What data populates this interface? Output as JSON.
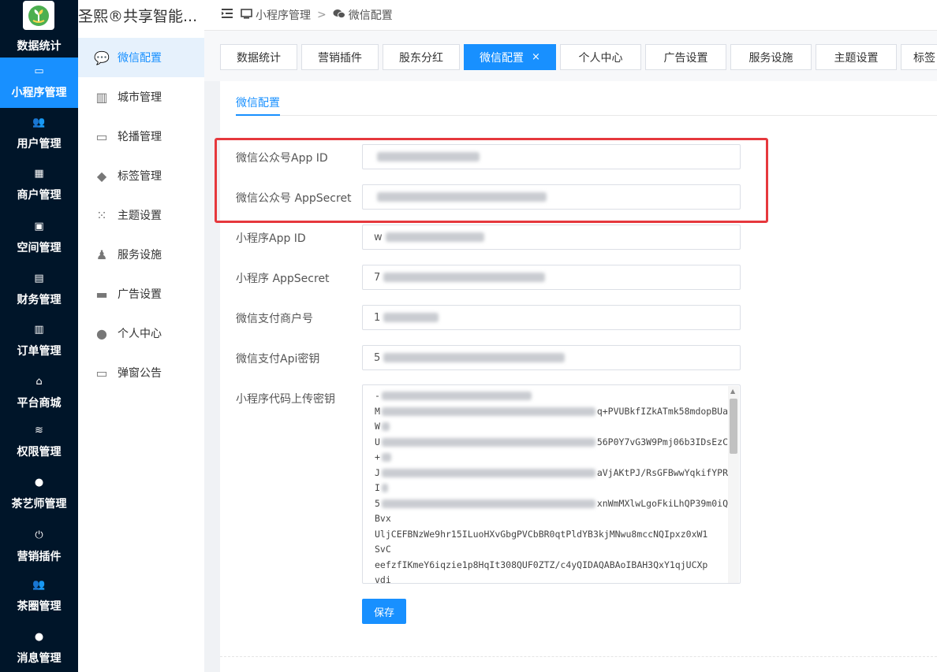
{
  "brand": {
    "app_name": "数据统计",
    "sub_title": "圣熙®共享智能..."
  },
  "nav": {
    "items": [
      {
        "label": "小程序管理",
        "icon": "monitor-icon",
        "glyph": "▭"
      },
      {
        "label": "用户管理",
        "icon": "users-icon",
        "glyph": "👥"
      },
      {
        "label": "商户管理",
        "icon": "building-icon",
        "glyph": "▦"
      },
      {
        "label": "空间管理",
        "icon": "box-icon",
        "glyph": "▣"
      },
      {
        "label": "财务管理",
        "icon": "card-icon",
        "glyph": "▤"
      },
      {
        "label": "订单管理",
        "icon": "clipboard-icon",
        "glyph": "▥"
      },
      {
        "label": "平台商城",
        "icon": "store-icon",
        "glyph": "⌂"
      },
      {
        "label": "权限管理",
        "icon": "database-icon",
        "glyph": "≋"
      },
      {
        "label": "茶艺师管理",
        "icon": "user-gear-icon",
        "glyph": "●"
      },
      {
        "label": "营销插件",
        "icon": "plug-icon",
        "glyph": "⏻"
      },
      {
        "label": "茶圈管理",
        "icon": "group-icon",
        "glyph": "👥"
      },
      {
        "label": "消息管理",
        "icon": "chat-icon",
        "glyph": "●"
      }
    ]
  },
  "submenu": {
    "items": [
      {
        "label": "微信配置",
        "icon": "wechat-icon",
        "glyph": "💬"
      },
      {
        "label": "城市管理",
        "icon": "city-icon",
        "glyph": "▥"
      },
      {
        "label": "轮播管理",
        "icon": "carousel-icon",
        "glyph": "▭"
      },
      {
        "label": "标签管理",
        "icon": "tags-icon",
        "glyph": "◆"
      },
      {
        "label": "主题设置",
        "icon": "grid-icon",
        "glyph": "⁙"
      },
      {
        "label": "服务设施",
        "icon": "chess-icon",
        "glyph": "♟"
      },
      {
        "label": "广告设置",
        "icon": "ad-card-icon",
        "glyph": "▬"
      },
      {
        "label": "个人中心",
        "icon": "user-icon",
        "glyph": "●"
      },
      {
        "label": "弹窗公告",
        "icon": "monitor-icon",
        "glyph": "▭"
      }
    ]
  },
  "header": {
    "crumb1": "小程序管理",
    "sep": ">",
    "crumb2": "微信配置"
  },
  "tabs": [
    {
      "label": "数据统计"
    },
    {
      "label": "营销插件"
    },
    {
      "label": "股东分红"
    },
    {
      "label": "微信配置",
      "close": "×"
    },
    {
      "label": "个人中心"
    },
    {
      "label": "广告设置"
    },
    {
      "label": "服务设施"
    },
    {
      "label": "主题设置"
    },
    {
      "label": "标签"
    }
  ],
  "form": {
    "section_tab": "微信配置",
    "fields": [
      {
        "label": "微信公众号App ID",
        "value_prefix": ""
      },
      {
        "label": "微信公众号 AppSecret",
        "value_prefix": ""
      },
      {
        "label": "小程序App ID",
        "value_prefix": "w"
      },
      {
        "label": "小程序 AppSecret",
        "value_prefix": "7"
      },
      {
        "label": "微信支付商户号",
        "value_prefix": "1"
      },
      {
        "label": "微信支付Api密钥",
        "value_prefix": "5"
      }
    ],
    "key_label": "小程序代码上传密钥",
    "key_lines": [
      {
        "prefix": "-",
        "suffix": ""
      },
      {
        "prefix": "M",
        "suffix": "q+PVUBkfIZkATmk58mdopBUa"
      },
      {
        "prefix": "W",
        "suffix": ""
      },
      {
        "prefix": "U",
        "suffix": "56P0Y7vG3W9Pmj06b3IDsEzC"
      },
      {
        "prefix": "+",
        "suffix": ""
      },
      {
        "prefix": "J",
        "suffix": "aVjAKtPJ/RsGFBwwYqkifYPR"
      },
      {
        "prefix": "I",
        "suffix": ""
      },
      {
        "prefix": "5",
        "suffix": "xnWmMXlwLgoFkiLhQP39m0iQ"
      },
      {
        "prefix": "Bvx",
        "suffix": ""
      },
      {
        "prefix": "UljCEFBNzWe9hr15ILuoHXvGbgPVCbBR0qtPldYB3kjMNwu8mccNQIpxz0xW1",
        "suffix": ""
      },
      {
        "prefix": "SvC",
        "suffix": ""
      },
      {
        "prefix": "eefzfIKmeY6iqzie1p8HqIt308QUF0ZTZ/c4yQIDAQABAoIBAH3QxY1qjUCXp",
        "suffix": ""
      },
      {
        "prefix": "vdi",
        "suffix": ""
      }
    ],
    "save_label": "保存"
  },
  "colors": {
    "accent": "#1890ff",
    "nav_bg": "#001529",
    "highlight": "#e6383d"
  }
}
